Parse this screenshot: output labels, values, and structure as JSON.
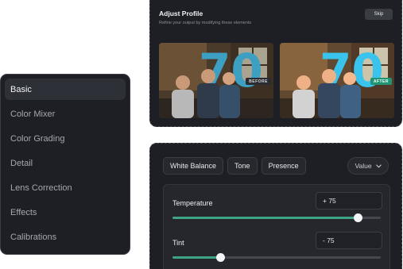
{
  "sidebar": {
    "items": [
      {
        "label": "Basic",
        "active": true
      },
      {
        "label": "Color Mixer",
        "active": false
      },
      {
        "label": "Color Grading",
        "active": false
      },
      {
        "label": "Detail",
        "active": false
      },
      {
        "label": "Lens Correction",
        "active": false
      },
      {
        "label": "Effects",
        "active": false
      },
      {
        "label": "Calibrations",
        "active": false
      }
    ]
  },
  "profile": {
    "title": "Adjust Profile",
    "subtitle": "Refine your output by modifying these elements",
    "skip_label": "Skip",
    "before_label": "BEFORE",
    "after_label": "AFTER"
  },
  "adjust": {
    "tabs": [
      "White Balance",
      "Tone",
      "Presence"
    ],
    "value_dropdown": "Value",
    "sliders": [
      {
        "label": "Temperature",
        "value_text": "+ 75",
        "fraction": 0.89
      },
      {
        "label": "Tint",
        "value_text": "- 75",
        "fraction": 0.23
      }
    ]
  },
  "colors": {
    "accent": "#3fa485",
    "panel": "#1d1f24",
    "after_badge": "#2b8a6e"
  },
  "icons": {
    "dropdown": "chevron-down-icon"
  }
}
